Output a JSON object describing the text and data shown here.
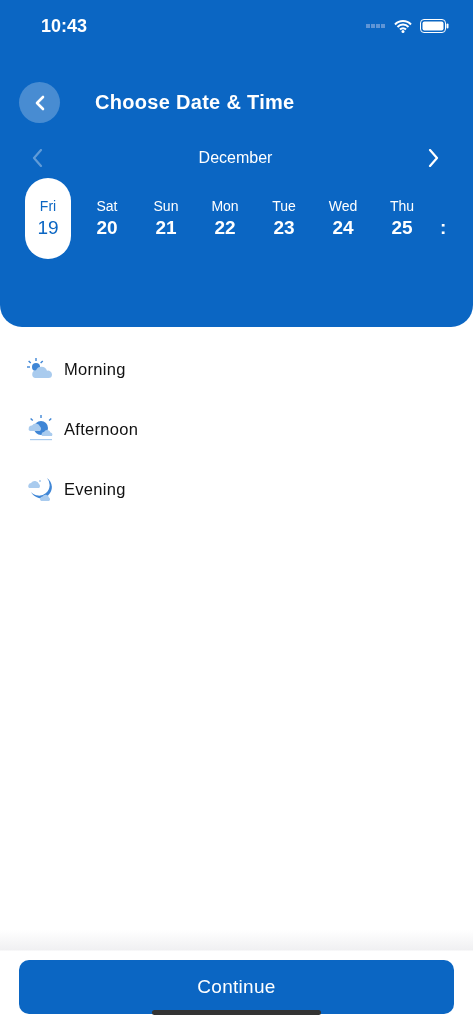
{
  "status_bar": {
    "time": "10:43"
  },
  "header": {
    "title": "Choose Date & Time"
  },
  "month_nav": {
    "month": "December",
    "prev_disabled": true,
    "next_disabled": false
  },
  "days": [
    {
      "weekday": "Fri",
      "date": "19",
      "selected": true
    },
    {
      "weekday": "Sat",
      "date": "20",
      "selected": false
    },
    {
      "weekday": "Sun",
      "date": "21",
      "selected": false
    },
    {
      "weekday": "Mon",
      "date": "22",
      "selected": false
    },
    {
      "weekday": "Tue",
      "date": "23",
      "selected": false
    },
    {
      "weekday": "Wed",
      "date": "24",
      "selected": false
    },
    {
      "weekday": "Thu",
      "date": "25",
      "selected": false
    }
  ],
  "cut_off_day": ":",
  "periods": [
    {
      "kind": "morning",
      "label": "Morning"
    },
    {
      "kind": "afternoon",
      "label": "Afternoon"
    },
    {
      "kind": "evening",
      "label": "Evening"
    }
  ],
  "button": "Continue"
}
